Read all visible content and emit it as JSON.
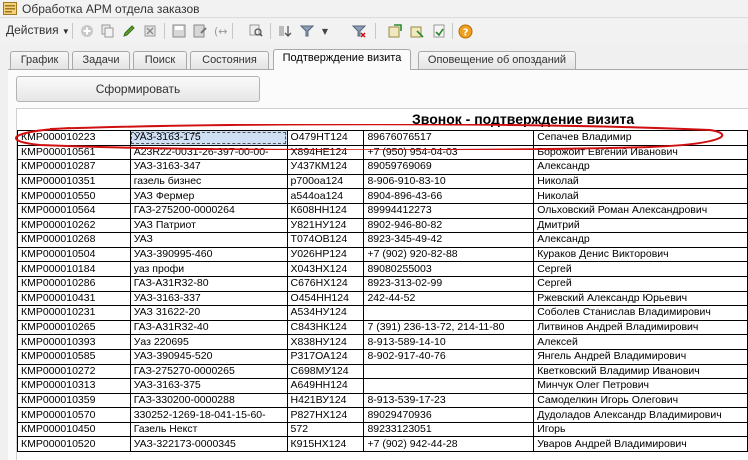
{
  "window": {
    "title": "Обработка  АРМ отдела заказов"
  },
  "toolbar": {
    "actions_label": "Действия",
    "icons": [
      "add-icon",
      "copy-icon",
      "edit-icon",
      "delete-icon",
      "save-icon",
      "save-as-icon",
      "link-icon",
      "search-icon",
      "sort-icon",
      "filter-icon",
      "clear-filter-icon",
      "import-icon",
      "export-icon",
      "refresh-icon",
      "help-icon"
    ]
  },
  "tabs": [
    {
      "label": "График"
    },
    {
      "label": "Задачи"
    },
    {
      "label": "Поиск"
    },
    {
      "label": "Состояния"
    },
    {
      "label": "Подтверждение визита"
    },
    {
      "label": "Оповещение об опозданий"
    }
  ],
  "active_tab": "Подтверждение визита",
  "form_button": {
    "label": "Сформировать"
  },
  "report": {
    "title": "Звонок - подтверждение визита",
    "rows": [
      [
        "КМР000010223",
        "УАЗ-3163-175",
        "О479НТ124",
        "89676076517",
        "Сепачев Владимир"
      ],
      [
        "КМР000010561",
        "А23R22-0031-26-397-00-00-",
        "Х894НЕ124",
        "+7 (950) 954-04-03",
        "Борожойт Евгений Иванович"
      ],
      [
        "КМР000010287",
        "УАЗ-3163-347",
        "У437КМ124",
        "89059769069",
        " Александр"
      ],
      [
        "КМР000010351",
        "газель бизнес",
        "р700оа124",
        "8-906-910-83-10",
        " Николай"
      ],
      [
        "КМР000010550",
        "УАЗ Фермер",
        "а544оа124",
        "8904-896-43-66",
        " Николай"
      ],
      [
        "КМР000010564",
        "ГАЗ-275200-0000264",
        "К608НН124",
        "89994412273",
        "Ольховский Роман Александрович"
      ],
      [
        "КМР000010262",
        "УАЗ Патриот",
        "У821НУ124",
        "8902-946-80-82",
        " Дмитрий"
      ],
      [
        "КМР000010268",
        "УАЗ",
        "Т074ОВ124",
        "8923-345-49-42",
        " Александр"
      ],
      [
        "КМР000010504",
        "УАЗ-390995-460",
        "У026НР124",
        "+7 (902) 920-82-88",
        "Кураков Денис Викторович"
      ],
      [
        "КМР000010184",
        "уаз профи",
        "Х043НХ124",
        "89080255003",
        " Сергей"
      ],
      [
        "КМР000010286",
        "ГАЗ-А31R32-80",
        "С676НХ124",
        "8923-313-02-99",
        " Сергей"
      ],
      [
        "КМР000010431",
        "УАЗ-3163-337",
        "О454НН124",
        "242-44-52",
        "Ржевский Александр Юрьевич"
      ],
      [
        "КМР000010231",
        "УАЗ 31622-20",
        "А534НУ124",
        "",
        "Соболев Станислав Владимирович"
      ],
      [
        "КМР000010265",
        "ГАЗ-А31R32-40",
        "С843НК124",
        "7 (391) 236-13-72, 214-11-80",
        "Литвинов Андрей Владимирович"
      ],
      [
        "КМР000010393",
        "Уаз 220695",
        "Х838НУ124",
        "8-913-589-14-10",
        " Алексей"
      ],
      [
        "КМР000010585",
        "УАЗ-390945-520",
        "Р317ОА124",
        "8-902-917-40-76",
        "Янгель Андрей Владимирович"
      ],
      [
        "КМР000010272",
        "ГАЗ-275270-0000265",
        "С698МУ124",
        "",
        "Кветковский Владимир Иванович"
      ],
      [
        "КМР000010313",
        "УАЗ-3163-375",
        "А649НН124",
        "",
        "Минчук Олег Петрович"
      ],
      [
        "КМР000010359",
        "ГАЗ-330200-0000288",
        "Н421ВУ124",
        "8-913-539-17-23",
        "Самоделкин Игорь Олегович"
      ],
      [
        "КМР000010570",
        "330252-1269-18-041-15-60-",
        "Р827НХ124",
        "89029470936",
        "Дудоладов Александр Владимирович"
      ],
      [
        "КМР000010450",
        "Газель Некст",
        "572",
        "89233123051",
        " Игорь"
      ],
      [
        "КМР000010520",
        "УАЗ-322173-0000345",
        "К915НХ124",
        "+7 (902) 942-44-28",
        "Уваров Андрей Владимирович"
      ]
    ]
  },
  "colors": {
    "annotation_ellipse": "#d01010",
    "selection": "#cfe0f5"
  }
}
